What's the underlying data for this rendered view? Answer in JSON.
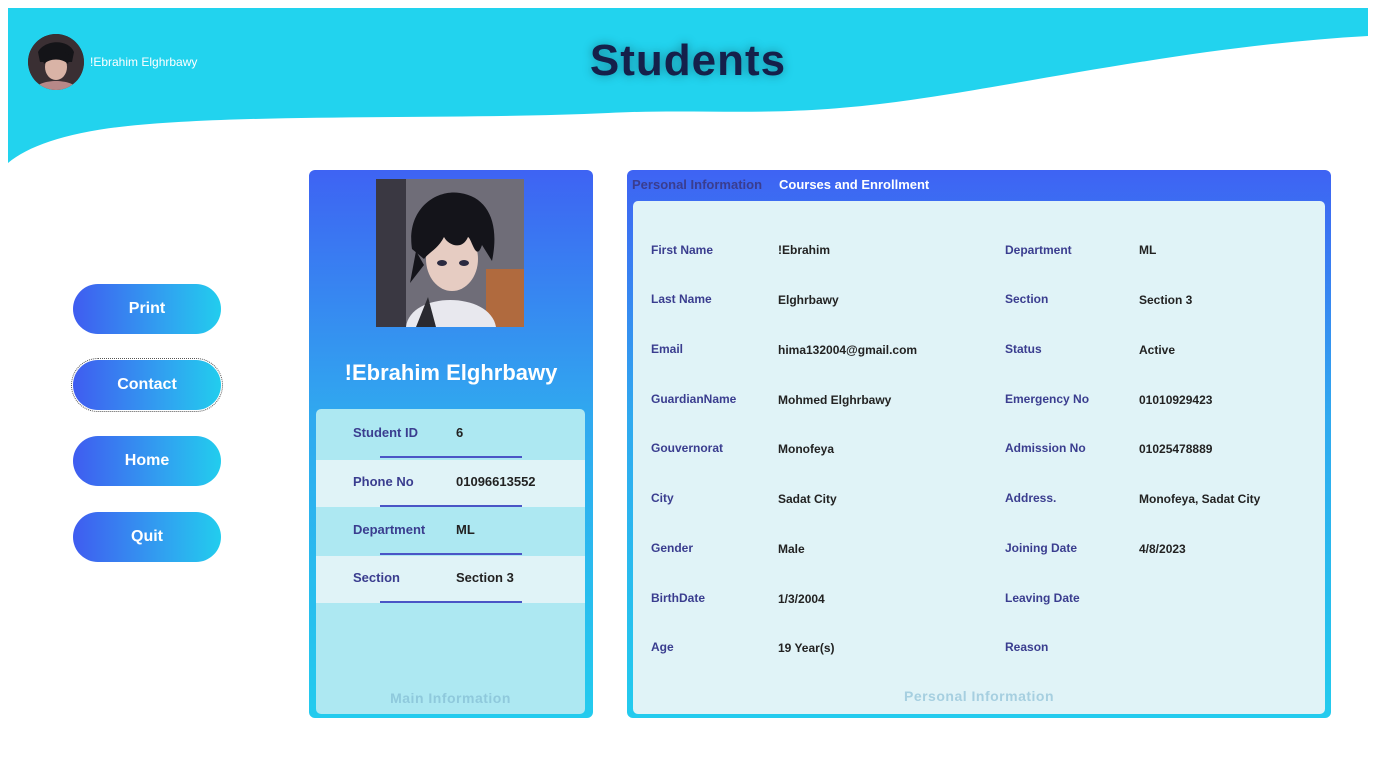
{
  "header": {
    "title": "Students",
    "user_name": "!Ebrahim Elghrbawy"
  },
  "nav": {
    "print": "Print",
    "contact": "Contact",
    "home": "Home",
    "quit": "Quit"
  },
  "main_card": {
    "name": "!Ebrahim Elghrbawy",
    "rows": [
      {
        "label": "Student ID",
        "value": "6"
      },
      {
        "label": "Phone No",
        "value": "01096613552"
      },
      {
        "label": "Department",
        "value": "ML"
      },
      {
        "label": "Section",
        "value": "Section 3"
      }
    ],
    "caption": "Main Information"
  },
  "details": {
    "tabs": [
      "Personal Information",
      "Courses and Enrollment"
    ],
    "left": [
      {
        "label": "First Name",
        "value": "!Ebrahim"
      },
      {
        "label": "Last Name",
        "value": "Elghrbawy"
      },
      {
        "label": "Email",
        "value": "hima132004@gmail.com"
      },
      {
        "label": "GuardianName",
        "value": "Mohmed Elghrbawy"
      },
      {
        "label": "Gouvernorat",
        "value": "Monofeya"
      },
      {
        "label": "City",
        "value": "Sadat City"
      },
      {
        "label": "Gender",
        "value": "Male"
      },
      {
        "label": "BirthDate",
        "value": "1/3/2004"
      },
      {
        "label": "Age",
        "value": "19 Year(s)"
      }
    ],
    "right": [
      {
        "label": "Department",
        "value": "ML"
      },
      {
        "label": "Section",
        "value": "Section 3"
      },
      {
        "label": "Status",
        "value": "Active"
      },
      {
        "label": "Emergency No",
        "value": "01010929423"
      },
      {
        "label": "Admission No",
        "value": "01025478889"
      },
      {
        "label": "Address.",
        "value": "Monofeya, Sadat City"
      },
      {
        "label": "Joining Date",
        "value": "4/8/2023"
      },
      {
        "label": "Leaving Date",
        "value": ""
      },
      {
        "label": "Reason",
        "value": ""
      }
    ],
    "caption": "Personal Information"
  },
  "colors": {
    "header_wave": "#22d3ee",
    "title": "#15204a",
    "button_start": "#3f5cf0",
    "button_end": "#22cdee",
    "label": "#3a3d8f",
    "panel_light": "#e0f3f7",
    "panel_mid": "#ade8f2"
  },
  "icons": {
    "avatar": "user-avatar-image",
    "photo": "student-photo-image"
  }
}
